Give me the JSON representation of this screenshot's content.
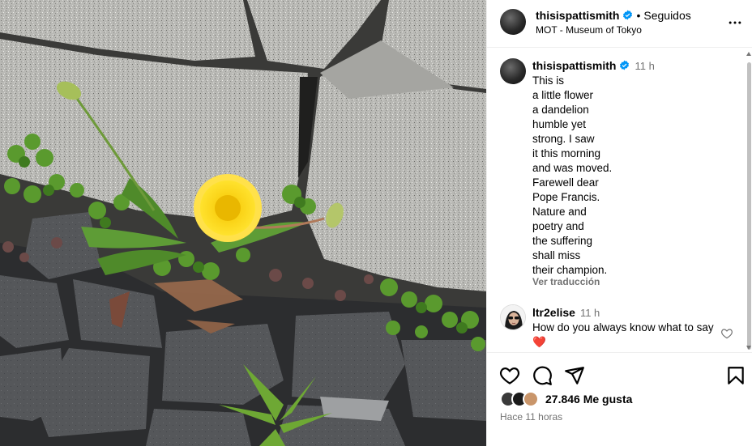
{
  "post": {
    "author": "thisispattismith",
    "follow_status": "Seguidos",
    "separator": "•",
    "location": "MOT - Museum of Tokyo"
  },
  "caption": {
    "author": "thisispattismith",
    "time": "11 h",
    "lines": [
      "This is",
      "a little flower",
      "a dandelion",
      "humble yet",
      "strong. I saw",
      "it this morning",
      "and was moved.",
      "Farewell dear",
      "Pope Francis.",
      "Nature and",
      "poetry and",
      "the suffering",
      "shall miss",
      "their champion."
    ],
    "translate_label": "Ver traducción"
  },
  "comment": {
    "author": "ltr2elise",
    "time": "11 h",
    "text": "How do you always know what to say ❤️"
  },
  "stats": {
    "likes": "27.846 Me gusta",
    "posted_ago": "Hace 11 horas"
  },
  "icons": {
    "more": "more-horizontal-icon",
    "verified": "verified-badge-icon",
    "like": "heart-icon",
    "comment": "comment-icon",
    "share": "share-icon",
    "save": "bookmark-icon",
    "comment_like": "heart-icon"
  },
  "colors": {
    "verified": "#0095f6",
    "secondary_text": "#737373",
    "divider": "#efefef",
    "heart_red": "#ed4956"
  }
}
